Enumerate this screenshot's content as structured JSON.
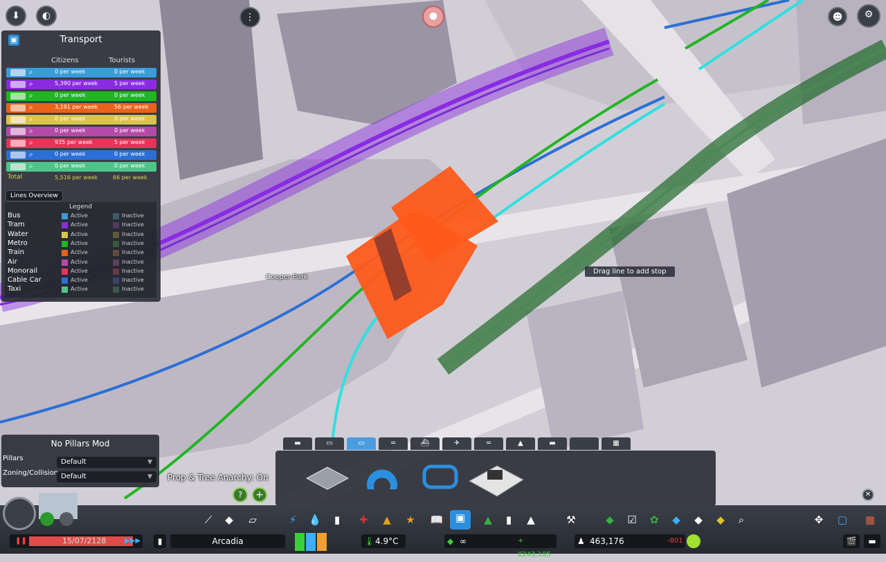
{
  "transport": {
    "title": "Transport",
    "col_citizens": "Citizens",
    "col_tourists": "Tourists",
    "rows": [
      {
        "mode": "bus",
        "color": "#3a9bd9",
        "citizens": "0 per week",
        "tourists": "0 per week"
      },
      {
        "mode": "tram",
        "color": "#8a2be2",
        "citizens": "5,390 per week",
        "tourists": "5 per week"
      },
      {
        "mode": "metro",
        "color": "#22b522",
        "citizens": "0 per week",
        "tourists": "0 per week"
      },
      {
        "mode": "train",
        "color": "#e8631a",
        "citizens": "3,191 per week",
        "tourists": "56 per week"
      },
      {
        "mode": "ship",
        "color": "#d8c44a",
        "citizens": "0 per week",
        "tourists": "0 per week"
      },
      {
        "mode": "air",
        "color": "#b44aa8",
        "citizens": "0 per week",
        "tourists": "0 per week"
      },
      {
        "mode": "monorail",
        "color": "#e8325a",
        "citizens": "935 per week",
        "tourists": "5 per week"
      },
      {
        "mode": "cable-car",
        "color": "#2b6fd6",
        "citizens": "0 per week",
        "tourists": "0 per week"
      },
      {
        "mode": "taxi",
        "color": "#4fc48a",
        "citizens": "0 per week",
        "tourists": "0 per week"
      }
    ],
    "total_label": "Total",
    "total_citizens": "5,516 per week",
    "total_tourists": "66 per week",
    "lines_overview_label": "Lines Overview",
    "legend_title": "Legend",
    "legend": [
      {
        "name": "Bus",
        "active_color": "#3a9bd9",
        "inactive_color": "#3f5a6a"
      },
      {
        "name": "Tram",
        "active_color": "#8a2be2",
        "inactive_color": "#4f3a63"
      },
      {
        "name": "Water",
        "active_color": "#d8c44a",
        "inactive_color": "#5f5a3a"
      },
      {
        "name": "Metro",
        "active_color": "#22b522",
        "inactive_color": "#3a5a3a"
      },
      {
        "name": "Train",
        "active_color": "#e8631a",
        "inactive_color": "#634a3a"
      },
      {
        "name": "Air",
        "active_color": "#b44aa8",
        "inactive_color": "#5a3f58"
      },
      {
        "name": "Monorail",
        "active_color": "#e8325a",
        "inactive_color": "#633a45"
      },
      {
        "name": "Cable Car",
        "active_color": "#2b6fd6",
        "inactive_color": "#3a4563"
      },
      {
        "name": "Taxi",
        "active_color": "#4fc48a",
        "inactive_color": "#3a5a4a"
      }
    ],
    "active_label": "Active",
    "inactive_label": "Inactive"
  },
  "pillars_mod": {
    "title": "No Pillars Mod",
    "pillars_label": "Pillars",
    "pillars_value": "Default",
    "zoning_label": "Zoning/Collision",
    "zoning_value": "Default"
  },
  "anarchy_status": "Prop & Tree Anarchy: On",
  "map": {
    "park_label": "Cooper Park",
    "tooltip": "Drag line to add stop"
  },
  "status_bar": {
    "date": "15/07/2128",
    "city_name": "Arcadia",
    "temperature": "4.9°C",
    "money_infinite": "∞",
    "income": "+₢243,185",
    "population": "463,176",
    "population_change": "-801"
  },
  "colors": {
    "tram_line": "#8a2be2",
    "metro_line": "#22b522",
    "bus_line": "#2b6fd6",
    "cable_line": "#2fe0e0",
    "monorail_track": "#1f6a2a",
    "station_overlay": "#ff5a1a"
  },
  "icons": {
    "transport": "bus-icon",
    "bulldoze": "bulldoze-icon",
    "info": "info-icon",
    "traffic": "traffic-light-icon",
    "unlock": "unlock-icon",
    "achievements": "achievements-icon",
    "settings": "gear-icon"
  }
}
